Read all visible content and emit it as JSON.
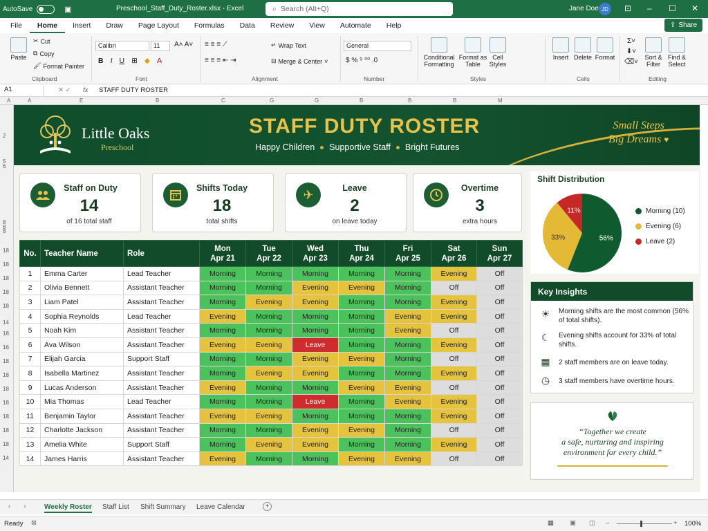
{
  "titlebar": {
    "autosave_label": "AutoSave",
    "document_title": "Preschool_Staff_Duty_Roster.xlsx - Excel",
    "search_placeholder": "Search (Alt+Q)",
    "user_name": "Jane Doe",
    "user_initials": "JD"
  },
  "menu": {
    "items": [
      "File",
      "Home",
      "Insert",
      "Draw",
      "Page Layout",
      "Formulas",
      "Data",
      "Review",
      "View",
      "Automate",
      "Help"
    ],
    "active": "Home",
    "share_label": "Share"
  },
  "ribbon": {
    "clipboard": {
      "paste": "Paste",
      "cut": "Cut",
      "copy": "Copy",
      "format_painter": "Format Painter",
      "label": "Clipboard"
    },
    "font": {
      "family": "Calibri",
      "size": "11",
      "label": "Font"
    },
    "alignment": {
      "wrap_text": "Wrap Text",
      "merge_center": "Merge & Center",
      "label": "Alignment"
    },
    "number": {
      "format": "General",
      "label": "Number"
    },
    "styles": {
      "conditional": "Conditional Formatting",
      "format_as_table": "Format as Table",
      "cell_styles": "Cell Styles",
      "label": "Styles"
    },
    "cells": {
      "insert": "Insert",
      "delete": "Delete",
      "format": "Format",
      "label": "Cells"
    },
    "editing": {
      "sort_filter": "Sort & Filter",
      "find_select": "Find & Select",
      "label": "Editing"
    }
  },
  "formula_bar": {
    "name_box": "A1",
    "fx": "fx",
    "content": "STAFF DUTY ROSTER"
  },
  "grid": {
    "columns": [
      "A",
      "A",
      "E",
      "B",
      "C",
      "G",
      "G",
      "B",
      "B",
      "B",
      "M"
    ],
    "rows": [
      "2",
      "5",
      "6",
      "8",
      "8",
      "8",
      "18",
      "18",
      "18",
      "18",
      "18",
      "14",
      "18",
      "16",
      "18",
      "18",
      "18",
      "18",
      "18",
      "18",
      "18",
      "14"
    ]
  },
  "banner": {
    "brand_name": "Little Oaks",
    "brand_sub": "Preschool",
    "title": "STAFF DUTY ROSTER",
    "tagline": [
      "Happy Children",
      "Supportive Staff",
      "Bright Futures"
    ],
    "motto_line1": "Small Steps",
    "motto_line2": "Big Dreams"
  },
  "kpis": [
    {
      "label": "Staff on Duty",
      "value": "14",
      "sub": "of 16 total staff",
      "icon": "people-icon"
    },
    {
      "label": "Shifts Today",
      "value": "18",
      "sub": "total shifts",
      "icon": "calendar-icon"
    },
    {
      "label": "Leave",
      "value": "2",
      "sub": "on leave today",
      "icon": "airplane-icon"
    },
    {
      "label": "Overtime",
      "value": "3",
      "sub": "extra hours",
      "icon": "clock-icon"
    }
  ],
  "roster": {
    "headers": {
      "no": "No.",
      "name": "Teacher Name",
      "role": "Role"
    },
    "days": [
      {
        "day": "Mon",
        "date": "Apr 21"
      },
      {
        "day": "Tue",
        "date": "Apr 22"
      },
      {
        "day": "Wed",
        "date": "Apr 23"
      },
      {
        "day": "Thu",
        "date": "Apr 24"
      },
      {
        "day": "Fri",
        "date": "Apr 25"
      },
      {
        "day": "Sat",
        "date": "Apr 26"
      },
      {
        "day": "Sun",
        "date": "Apr 27"
      }
    ],
    "rows": [
      {
        "no": "1",
        "name": "Emma Carter",
        "role": "Lead Teacher",
        "shifts": [
          "Morning",
          "Morning",
          "Morning",
          "Morning",
          "Morning",
          "Evening",
          "Off"
        ]
      },
      {
        "no": "2",
        "name": "Olivia Bennett",
        "role": "Assistant Teacher",
        "shifts": [
          "Morning",
          "Morning",
          "Evening",
          "Evening",
          "Morning",
          "Off",
          "Off"
        ]
      },
      {
        "no": "3",
        "name": "Liam Patel",
        "role": "Assistant Teacher",
        "shifts": [
          "Morning",
          "Evening",
          "Evening",
          "Morning",
          "Morning",
          "Evening",
          "Off"
        ]
      },
      {
        "no": "4",
        "name": "Sophia Reynolds",
        "role": "Lead Teacher",
        "shifts": [
          "Evening",
          "Morning",
          "Morning",
          "Morning",
          "Evening",
          "Evening",
          "Off"
        ]
      },
      {
        "no": "5",
        "name": "Noah Kim",
        "role": "Assistant Teacher",
        "shifts": [
          "Morning",
          "Morning",
          "Morning",
          "Morning",
          "Evening",
          "Off",
          "Off"
        ]
      },
      {
        "no": "6",
        "name": "Ava Wilson",
        "role": "Assistant Teacher",
        "shifts": [
          "Evening",
          "Evening",
          "Leave",
          "Morning",
          "Morning",
          "Evening",
          "Off"
        ]
      },
      {
        "no": "7",
        "name": "Elijah Garcia",
        "role": "Support Staff",
        "shifts": [
          "Morning",
          "Morning",
          "Evening",
          "Evening",
          "Morning",
          "Off",
          "Off"
        ]
      },
      {
        "no": "8",
        "name": "Isabella Martinez",
        "role": "Assistant Teacher",
        "shifts": [
          "Morning",
          "Evening",
          "Evening",
          "Morning",
          "Morning",
          "Evening",
          "Off"
        ]
      },
      {
        "no": "9",
        "name": "Lucas Anderson",
        "role": "Assistant Teacher",
        "shifts": [
          "Evening",
          "Morning",
          "Morning",
          "Evening",
          "Evening",
          "Off",
          "Off"
        ]
      },
      {
        "no": "10",
        "name": "Mia Thomas",
        "role": "Lead Teacher",
        "shifts": [
          "Morning",
          "Morning",
          "Leave",
          "Morning",
          "Evening",
          "Evening",
          "Off"
        ]
      },
      {
        "no": "11",
        "name": "Benjamin Taylor",
        "role": "Assistant Teacher",
        "shifts": [
          "Evening",
          "Evening",
          "Morning",
          "Morning",
          "Morning",
          "Evening",
          "Off"
        ]
      },
      {
        "no": "12",
        "name": "Charlotte Jackson",
        "role": "Assistant Teacher",
        "shifts": [
          "Morning",
          "Morning",
          "Evening",
          "Evening",
          "Morning",
          "Off",
          "Off"
        ]
      },
      {
        "no": "13",
        "name": "Amelia White",
        "role": "Support Staff",
        "shifts": [
          "Morning",
          "Evening",
          "Evening",
          "Morning",
          "Morning",
          "Evening",
          "Off"
        ]
      },
      {
        "no": "14",
        "name": "James Harris",
        "role": "Assistant Teacher",
        "shifts": [
          "Evening",
          "Morning",
          "Morning",
          "Evening",
          "Evening",
          "Off",
          "Off"
        ]
      }
    ]
  },
  "shift_distribution": {
    "title": "Shift Distribution",
    "slices": [
      {
        "name": "Morning (10)",
        "percent": 56,
        "label": "56%",
        "color": "#0f5a2e"
      },
      {
        "name": "Evening (6)",
        "percent": 33,
        "label": "33%",
        "color": "#e3b935"
      },
      {
        "name": "Leave (2)",
        "percent": 11,
        "label": "11%",
        "color": "#c62828"
      }
    ]
  },
  "insights": {
    "title": "Key Insights",
    "items": [
      {
        "icon": "sun-icon",
        "text": "Morning shifts are the most common (56% of total shifts)."
      },
      {
        "icon": "moon-icon",
        "text": "Evening shifts account for 33% of total shifts."
      },
      {
        "icon": "calendar-icon",
        "text": "2 staff members are on leave today."
      },
      {
        "icon": "clock-icon",
        "text": "3 staff members have overtime hours."
      }
    ]
  },
  "quote": {
    "line1": "“Together we create",
    "line2": "a safe, nurturing and inspiring",
    "line3": "environment for every child.”"
  },
  "sheet_tabs": [
    "Weekly Roster",
    "Staff List",
    "Shift Summary",
    "Leave Calendar"
  ],
  "active_tab": "Weekly Roster",
  "status": {
    "ready": "Ready",
    "zoom": "100%"
  },
  "colors": {
    "brand_green": "#124b29",
    "morning": "#4cc25c",
    "evening": "#e5c33d",
    "leave": "#cf2d2d",
    "off": "#dddddd",
    "gold": "#e9c24a"
  }
}
